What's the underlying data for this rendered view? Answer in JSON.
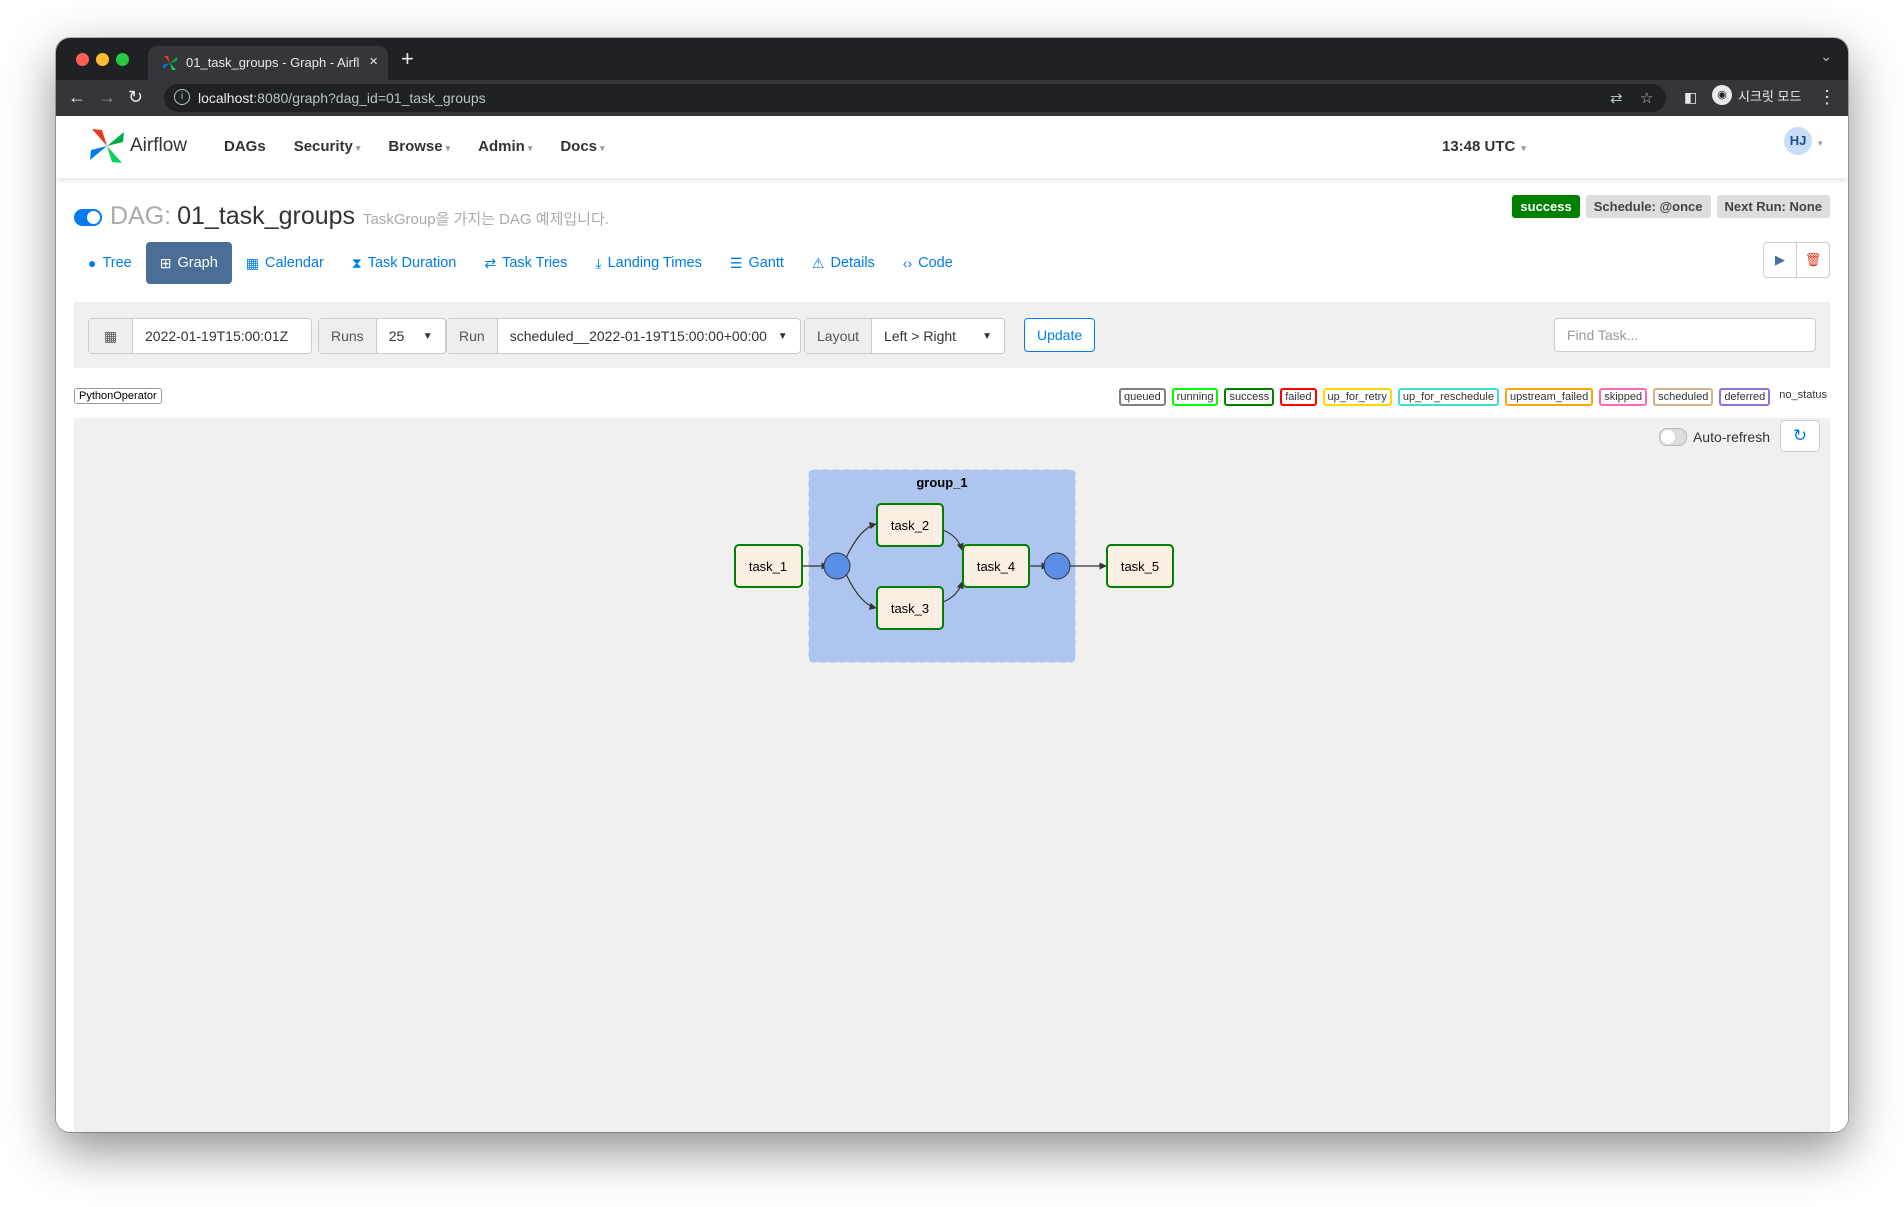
{
  "browser": {
    "tab_title": "01_task_groups - Graph - Airfl",
    "tab_close": "×",
    "new_tab": "+",
    "url_host": "localhost",
    "url_rest": ":8080/graph?dag_id=01_task_groups",
    "incognito_label": "시크릿 모드"
  },
  "navbar": {
    "brand": "Airflow",
    "menu": [
      "DAGs",
      "Security",
      "Browse",
      "Admin",
      "Docs"
    ],
    "clock": "13:48 UTC",
    "user_initials": "HJ"
  },
  "dag": {
    "prefix": "DAG:",
    "id": "01_task_groups",
    "description": "TaskGroup을 가지는 DAG 예제입니다.",
    "badges": {
      "status": "success",
      "schedule": "Schedule: @once",
      "next_run": "Next Run: None"
    }
  },
  "view_tabs": [
    "Tree",
    "Graph",
    "Calendar",
    "Task Duration",
    "Task Tries",
    "Landing Times",
    "Gantt",
    "Details",
    "Code"
  ],
  "active_tab": "Graph",
  "filters": {
    "base_date": "2022-01-19T15:00:01Z",
    "runs_label": "Runs",
    "runs_value": "25",
    "run_label": "Run",
    "run_value": "scheduled__2022-01-19T15:00:00+00:00",
    "layout_label": "Layout",
    "layout_value": "Left > Right",
    "update_button": "Update",
    "find_placeholder": "Find Task..."
  },
  "operator_legend": "PythonOperator",
  "state_legend": [
    "queued",
    "running",
    "success",
    "failed",
    "up_for_retry",
    "up_for_reschedule",
    "upstream_failed",
    "skipped",
    "scheduled",
    "deferred",
    "no_status"
  ],
  "state_colors": {
    "queued": "#808080",
    "running": "#00ff00",
    "success": "#008000",
    "failed": "#ff0000",
    "up_for_retry": "#ffd700",
    "up_for_reschedule": "#40e0d0",
    "upstream_failed": "#ffa500",
    "skipped": "#ff69b4",
    "scheduled": "#d2b48c",
    "deferred": "#9370db",
    "no_status": "#ffffff"
  },
  "graph": {
    "auto_refresh_label": "Auto-refresh",
    "group_label": "group_1",
    "tasks": [
      "task_1",
      "task_2",
      "task_3",
      "task_4",
      "task_5"
    ],
    "group_fill": "#aec6ef",
    "task_fill": "#fbefe4",
    "task_border": "#008000",
    "join_fill": "#5b8ee6"
  }
}
